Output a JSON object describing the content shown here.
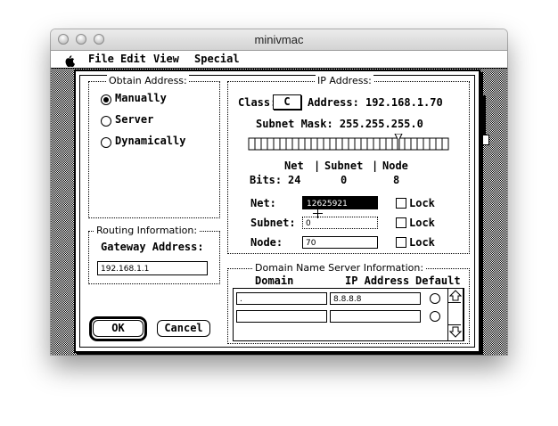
{
  "window": {
    "title": "minivmac"
  },
  "menubar": {
    "items": [
      "File",
      "Edit",
      "View",
      "Special"
    ]
  },
  "obtain": {
    "title": "Obtain Address:",
    "options": [
      {
        "label": "Manually",
        "selected": true
      },
      {
        "label": "Server",
        "selected": false
      },
      {
        "label": "Dynamically",
        "selected": false
      }
    ]
  },
  "routing": {
    "title": "Routing Information:",
    "gateway_label": "Gateway Address:",
    "gateway_value": "192.168.1.1"
  },
  "ip": {
    "title": "IP Address:",
    "class_label": "Class:",
    "class_value": "C",
    "address_label": "Address: 192.168.1.70",
    "subnet_mask": "Subnet Mask: 255.255.255.0",
    "slider_bits": 24,
    "slider_total": 32,
    "bits_label": "Bits:",
    "col_net": "Net",
    "col_subnet": "Subnet",
    "col_node": "Node",
    "sep": "|",
    "bits_net": "24",
    "bits_subnet": "0",
    "bits_node": "8",
    "net_label": "Net:",
    "net_value": "12625921",
    "subnet_label": "Subnet:",
    "subnet_value": "0",
    "node_label": "Node:",
    "node_value": "70",
    "lock_label": "Lock"
  },
  "dns": {
    "title": "Domain Name Server Information:",
    "col_domain": "Domain",
    "col_ip": "IP Address",
    "col_default": "Default",
    "rows": [
      {
        "domain": ".",
        "ip": "8.8.8.8"
      },
      {
        "domain": "",
        "ip": ""
      }
    ]
  },
  "buttons": {
    "ok": "OK",
    "cancel": "Cancel"
  }
}
